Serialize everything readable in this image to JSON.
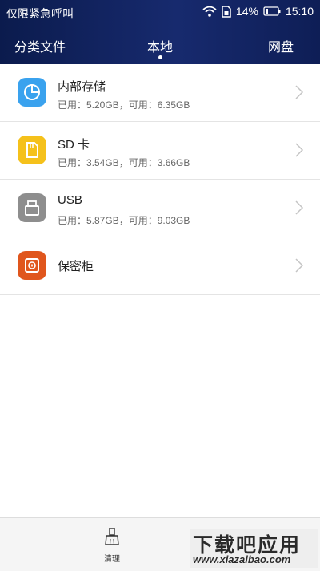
{
  "status_bar": {
    "carrier": "仅限紧急呼叫",
    "battery": "14%",
    "time": "15:10",
    "icons": [
      "wifi-icon",
      "sim-icon",
      "battery-icon"
    ]
  },
  "tabs": [
    {
      "label": "分类文件"
    },
    {
      "label": "本地",
      "active": true
    },
    {
      "label": "网盘"
    }
  ],
  "storage": [
    {
      "name": "内部存储",
      "usage": "已用：5.20GB，可用：6.35GB",
      "icon": "pie-chart-icon",
      "color": "#3aa2ee"
    },
    {
      "name": "SD 卡",
      "usage": "已用：3.54GB，可用：3.66GB",
      "icon": "sd-card-icon",
      "color": "#f5c11b"
    },
    {
      "name": "USB",
      "usage": "已用：5.87GB，可用：9.03GB",
      "icon": "usb-icon",
      "color": "#8e8e8e"
    },
    {
      "name": "保密柜",
      "usage": "",
      "icon": "safe-icon",
      "color": "#e0561d"
    }
  ],
  "bottom": {
    "clean_label": "清理",
    "clean_icon": "broom-icon"
  },
  "watermark": {
    "title": "下载吧应用",
    "url": "www.xiazaibao.com"
  },
  "colors": {
    "topbar": "#152766",
    "divider": "#e4e4e4"
  }
}
